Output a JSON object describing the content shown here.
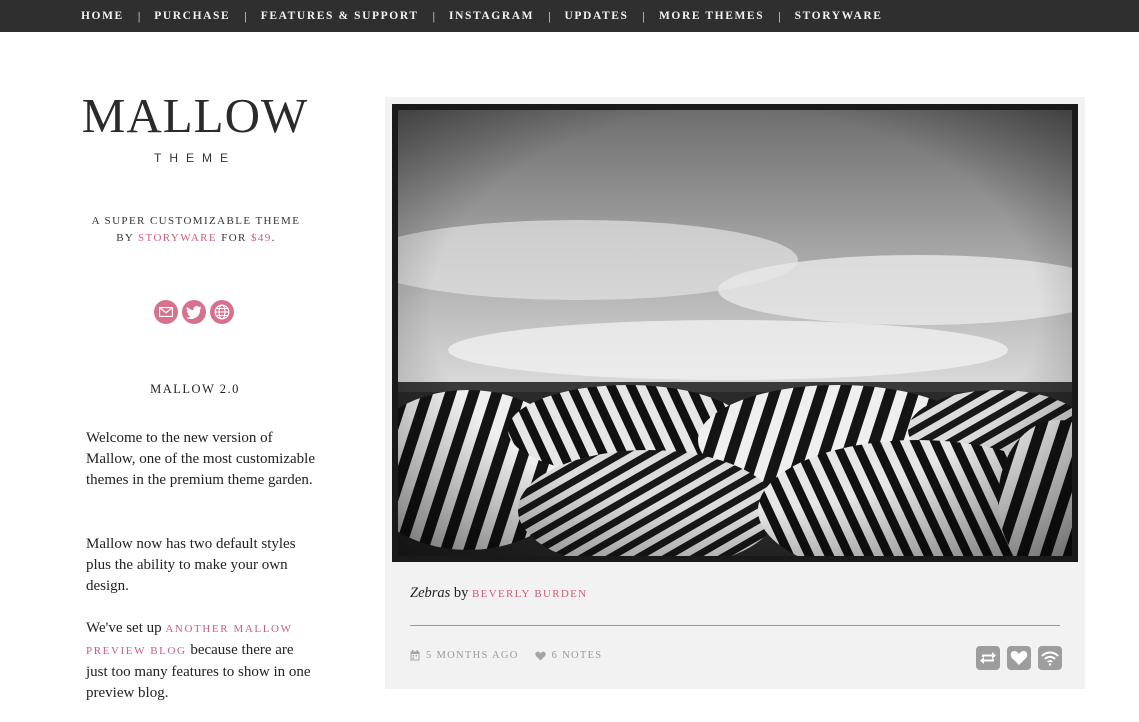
{
  "nav": {
    "items": [
      "HOME",
      "PURCHASE",
      "FEATURES & SUPPORT",
      "INSTAGRAM",
      "UPDATES",
      "MORE THEMES",
      "STORYWARE"
    ]
  },
  "sidebar": {
    "logo": "MALLOW",
    "logo_sub": "THEME",
    "tagline_1": "A SUPER CUSTOMIZABLE THEME",
    "tagline_by": "BY ",
    "tagline_author": "STORYWARE",
    "tagline_for": " FOR ",
    "tagline_price": "$49",
    "tagline_end": ".",
    "social_icons": [
      "mail-icon",
      "twitter-icon",
      "globe-icon"
    ],
    "version_title": "MALLOW 2.0",
    "para1": "Welcome to the new version of Mallow, one of the most customizable themes in the premium theme garden.",
    "para2": "Mallow now has two default styles plus the ability to make your own design.",
    "para3_start": "We've set up ",
    "para3_link": "ANOTHER MALLOW PREVIEW BLOG",
    "para3_end": " because there are just too many features to show in one preview blog."
  },
  "post": {
    "image_alt": "Zebras",
    "caption_title": "Zebras",
    "caption_by": " by ",
    "caption_author": "BEVERLY BURDEN",
    "time": "5 MONTHS AGO",
    "notes": "6 NOTES",
    "actions": [
      "reblog-icon",
      "heart-icon",
      "feed-icon"
    ]
  },
  "colors": {
    "nav_bg": "#2f2f2f",
    "accent": "#cf5d79",
    "card_bg": "#f2f2f2"
  }
}
